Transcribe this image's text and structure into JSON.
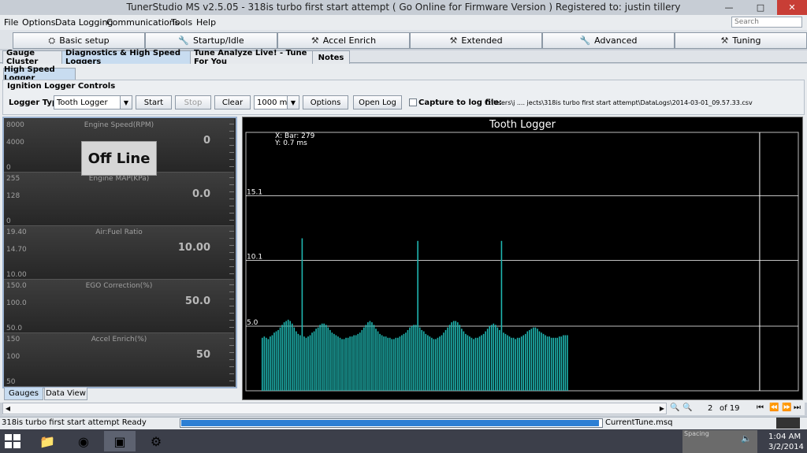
{
  "window": {
    "title": "TunerStudio MS v2.5.05 - 318is turbo first start attempt ( Go Online for Firmware Version ) Registered to: justin tillery",
    "minimize_glyph": "—",
    "maximize_glyph": "□",
    "close_glyph": "✕"
  },
  "menubar": {
    "items": [
      "File",
      "Options",
      "Data Logging",
      "Communications",
      "Tools",
      "Help"
    ],
    "search_placeholder": "Search"
  },
  "toolbar": {
    "buttons": [
      {
        "label": "Basic setup",
        "icon": "car-lift-icon"
      },
      {
        "label": "Startup/Idle",
        "icon": "wrench-icon"
      },
      {
        "label": "Accel Enrich",
        "icon": "tools-icon"
      },
      {
        "label": "Extended",
        "icon": "hammer-icon"
      },
      {
        "label": "Advanced",
        "icon": "wrench-icon"
      },
      {
        "label": "Tuning",
        "icon": "tools-icon"
      }
    ]
  },
  "tabs": {
    "items": [
      "Gauge Cluster",
      "Diagnostics & High Speed Loggers",
      "Tune Analyze Live! - Tune For You",
      "Notes"
    ],
    "active": 1
  },
  "subtab": "High Speed Logger",
  "controls": {
    "panel_title": "Ignition Logger Controls",
    "logger_type_label": "Logger Type:",
    "logger_type_value": "Tooth Logger",
    "start": "Start",
    "stop": "Stop",
    "clear": "Clear",
    "interval_value": "1000 ms",
    "options": "Options",
    "open_log": "Open Log",
    "capture_label": "Capture to log file:",
    "capture_checked": false,
    "log_path": "C:\\Users\\j .... jects\\318is turbo first start attempt\\DataLogs\\2014-03-01_09.57.33.csv"
  },
  "gauges": [
    {
      "title": "Engine Speed(RPM)",
      "max": "8000",
      "mid": "4000",
      "min": "0",
      "value": "0"
    },
    {
      "title": "Engine MAP(KPa)",
      "max": "255",
      "mid": "128",
      "min": "0",
      "value": "0.0"
    },
    {
      "title": "Air:Fuel Ratio",
      "max": "19.40",
      "mid": "14.70",
      "min": "10.00",
      "value": "10.00"
    },
    {
      "title": "EGO Correction(%)",
      "max": "150.0",
      "mid": "100.0",
      "min": "50.0",
      "value": "50.0"
    },
    {
      "title": "Accel Enrich(%)",
      "max": "150",
      "mid": "100",
      "min": "50",
      "value": "50"
    }
  ],
  "offline_text": "Off Line",
  "bottom_tabs": {
    "items": [
      "Gauges",
      "Data View"
    ],
    "active": 0
  },
  "colors": {
    "bar": "#1fb5b0",
    "grid": "#ffffff",
    "background": "#000000",
    "progress": "#2d7fd4"
  },
  "chart_data": {
    "type": "bar",
    "title": "Tooth Logger",
    "readout": {
      "x": "X: Bar: 279",
      "y": "Y: 0.7 ms"
    },
    "yticks": [
      "15.1",
      "10.1",
      "5.0"
    ],
    "ytick_values": [
      15.1,
      10.1,
      5.0
    ],
    "ylim": [
      0,
      20
    ],
    "cursor_bar": 279,
    "xlim": [
      0,
      300
    ],
    "values": [
      4.1,
      4.2,
      4.1,
      4.0,
      4.2,
      4.3,
      4.5,
      4.6,
      4.7,
      4.9,
      5.1,
      5.3,
      5.4,
      5.5,
      5.4,
      5.2,
      4.9,
      4.6,
      4.4,
      4.3,
      11.8,
      4.2,
      4.1,
      4.2,
      4.3,
      4.5,
      4.6,
      4.8,
      4.9,
      5.1,
      5.2,
      5.2,
      5.1,
      4.9,
      4.7,
      4.5,
      4.4,
      4.3,
      4.2,
      4.1,
      4.0,
      4.0,
      4.1,
      4.1,
      4.2,
      4.2,
      4.3,
      4.3,
      4.4,
      4.5,
      4.7,
      4.9,
      5.1,
      5.3,
      5.4,
      5.3,
      5.1,
      4.8,
      4.6,
      4.4,
      4.3,
      4.2,
      4.2,
      4.1,
      4.1,
      4.0,
      4.0,
      4.1,
      4.1,
      4.2,
      4.3,
      4.4,
      4.5,
      4.7,
      4.9,
      5.0,
      5.1,
      5.1,
      11.6,
      4.9,
      4.7,
      4.6,
      4.4,
      4.3,
      4.2,
      4.1,
      4.0,
      4.0,
      4.1,
      4.2,
      4.3,
      4.5,
      4.7,
      4.9,
      5.1,
      5.3,
      5.4,
      5.4,
      5.3,
      5.1,
      4.8,
      4.6,
      4.4,
      4.3,
      4.2,
      4.1,
      4.0,
      4.1,
      4.1,
      4.2,
      4.3,
      4.4,
      4.6,
      4.8,
      5.0,
      5.1,
      5.2,
      5.1,
      4.9,
      4.7,
      11.6,
      4.5,
      4.4,
      4.3,
      4.2,
      4.1,
      4.1,
      4.0,
      4.1,
      4.1,
      4.2,
      4.3,
      4.4,
      4.6,
      4.7,
      4.8,
      4.9,
      4.9,
      4.8,
      4.6,
      4.5,
      4.4,
      4.3,
      4.2,
      4.2,
      4.1,
      4.1,
      4.1,
      4.1,
      4.2,
      4.2,
      4.3,
      4.3,
      4.3
    ],
    "page": "2",
    "page_of": "of 19"
  },
  "status": {
    "left": "318is turbo first start attempt Ready",
    "progress": 0.99,
    "file": "CurrentTune.msq"
  },
  "taskbar": {
    "tray_label": "Spacing",
    "time": "1:04 AM",
    "date": "3/2/2014"
  }
}
